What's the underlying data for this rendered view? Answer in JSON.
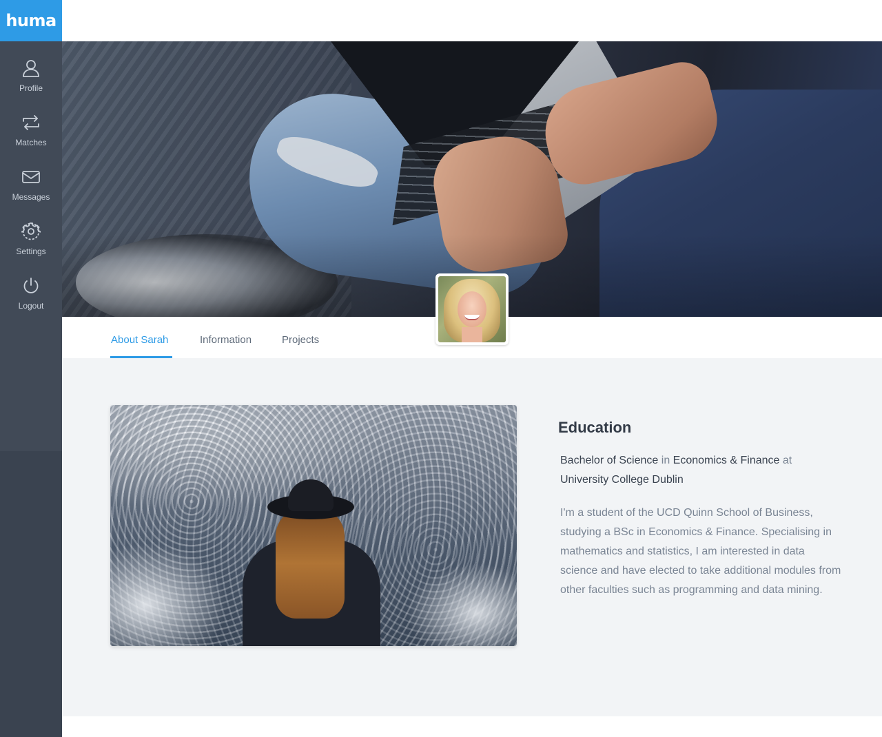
{
  "app": {
    "logo": "huma",
    "brand_color": "#2e9be6"
  },
  "sidebar": {
    "items": [
      {
        "label": "Profile",
        "icon": "user-icon"
      },
      {
        "label": "Matches",
        "icon": "repeat-icon"
      },
      {
        "label": "Messages",
        "icon": "envelope-icon"
      },
      {
        "label": "Settings",
        "icon": "gear-icon"
      },
      {
        "label": "Logout",
        "icon": "power-icon"
      }
    ]
  },
  "tabs": [
    {
      "label": "About Sarah",
      "active": true
    },
    {
      "label": "Information",
      "active": false
    },
    {
      "label": "Projects",
      "active": false
    }
  ],
  "education": {
    "title": "Education",
    "degree": "Bachelor of Science",
    "in_word": "in",
    "field": "Economics & Finance",
    "at_word": "at",
    "school": "University College Dublin",
    "bio": "I'm a student of the UCD Quinn School of Business, studying a BSc in Economics & Finance. Specialising in mathematics and statistics, I am interested in data science and have elected to take additional modules from other faculties such as programming and data mining."
  }
}
